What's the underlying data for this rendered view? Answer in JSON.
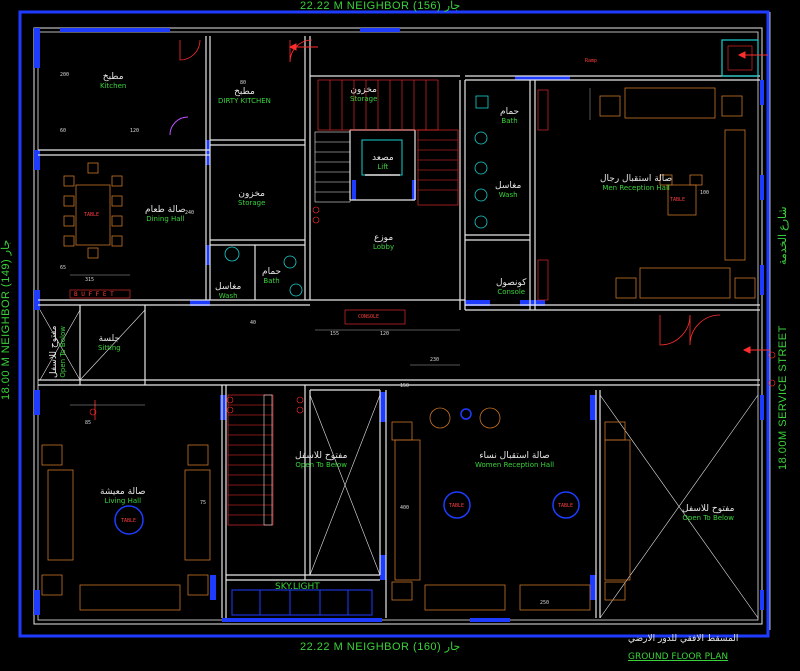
{
  "edges": {
    "top": "22.22 M NEIGHBOR (156) جار",
    "bottom": "22.22 M NEIGHBOR (160) جار",
    "left": "18.00 M NEIGHBOR (149) جار",
    "right_street": "18.00M SERVICE STREET",
    "right_arabic": "شارع الخدمة"
  },
  "rooms": {
    "kitchen_ar": "مطبخ",
    "kitchen_en": "Kitchen",
    "dirty_kitchen_ar": "مطبخ",
    "dirty_kitchen_en": "DIRTY KITCHEN",
    "storage1_ar": "مخزون",
    "storage1_en": "Storage",
    "storage2_ar": "مخزون",
    "storage2_en": "Storage",
    "dining_ar": "صالة طعام",
    "dining_en": "Dining Hall",
    "bath1_ar": "حمام",
    "bath1_en": "Bath",
    "wash1_ar": "مغاسل",
    "wash1_en": "Wash",
    "lift_ar": "مصعد",
    "lift_en": "Lift",
    "lobby_ar": "موزع",
    "lobby_en": "Lobby",
    "bath2_ar": "حمام",
    "bath2_en": "Bath",
    "wash2_ar": "مغاسل",
    "wash2_en": "Wash",
    "console_ar": "كونصول",
    "console_en": "Console",
    "men_ar": "صالة استقبال رجال",
    "men_en": "Men Reception Hall",
    "sitting_ar": "جلسة",
    "sitting_en": "Sitting",
    "open1_ar": "مفتوح للاسفل",
    "open1_en": "Open To Below",
    "open2_ar": "مفتوح للاسفل",
    "open2_en": "Open To Below",
    "open3_ar": "مفتوح للاسفل",
    "open3_en": "Open To Below",
    "women_ar": "صالة استقبال نساء",
    "women_en": "Women Reception Hall",
    "living_ar": "صالة معيشة",
    "living_en": "Living Hall",
    "skylight": "SKY.LIGHT"
  },
  "fixtures": {
    "buffet": "B U F F E T",
    "console": "CONSOLE",
    "table": "TABLE",
    "ramp": "Ramp"
  },
  "dimensions": [
    "200",
    "120",
    "60",
    "240",
    "315",
    "155",
    "120",
    "230",
    "100",
    "85",
    "65",
    "80",
    "40",
    "150",
    "400",
    "250",
    "75"
  ],
  "title": {
    "arabic": "المسقط الافقي للدور الارضي",
    "english": "GROUND FLOOR PLAN"
  },
  "colors": {
    "wall": "#e6e6e6",
    "accent_blue": "#1e3cff",
    "label_green": "#3ad23a",
    "furniture": "#c8742a",
    "red": "#ff2d2d",
    "cyan": "#19d0d0"
  }
}
